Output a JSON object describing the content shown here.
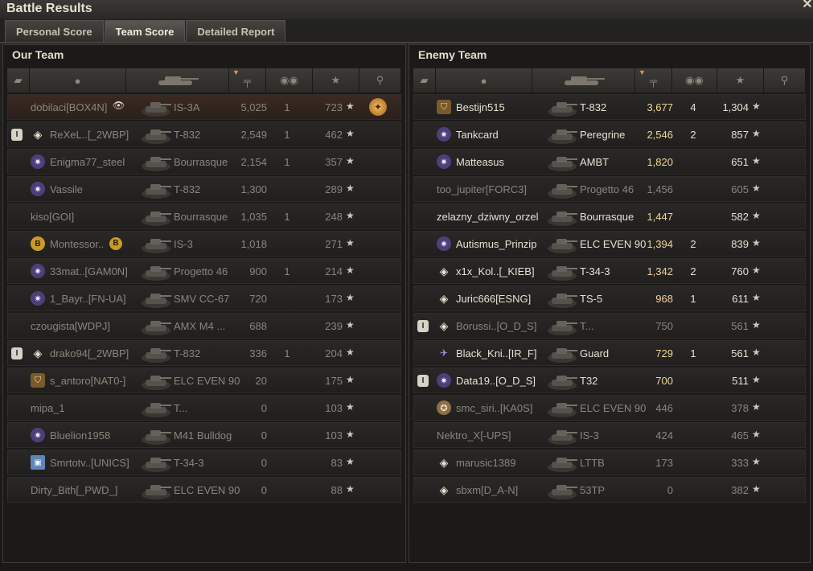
{
  "window": {
    "title": "Battle Results",
    "close_label": "✕"
  },
  "tabs": [
    {
      "label": "Personal Score",
      "active": false
    },
    {
      "label": "Team Score",
      "active": true
    },
    {
      "label": "Detailed Report",
      "active": false
    }
  ],
  "header_icons": [
    "platoon-icon",
    "player-icon",
    "vehicle-icon",
    "damage-icon",
    "kills-icon",
    "xp-star-icon",
    "medal-icon"
  ],
  "our_team": {
    "title": "Our Team",
    "rows": [
      {
        "name": "dobilaci[BOX4N]",
        "tank": "IS-3A",
        "damage": "5,025",
        "kills": "1",
        "xp": "723",
        "badge": "",
        "platoon": "",
        "alive": false,
        "me": true,
        "eye": true,
        "medal": true
      },
      {
        "name": "ReXeL..[_2WBP]",
        "tank": "T-832",
        "damage": "2,549",
        "kills": "1",
        "xp": "462",
        "badge": "diamond",
        "platoon": "I",
        "alive": false
      },
      {
        "name": "Enigma77_steel",
        "tank": "Bourrasque",
        "damage": "2,154",
        "kills": "1",
        "xp": "357",
        "badge": "star",
        "platoon": "",
        "alive": false
      },
      {
        "name": "Vassile",
        "tank": "T-832",
        "damage": "1,300",
        "kills": "",
        "xp": "289",
        "badge": "star",
        "platoon": "",
        "alive": false
      },
      {
        "name": "kiso[GOI]",
        "tank": "Bourrasque",
        "damage": "1,035",
        "kills": "1",
        "xp": "248",
        "badge": "",
        "platoon": "",
        "alive": false
      },
      {
        "name": "Montessor..",
        "tank": "IS-3",
        "damage": "1,018",
        "kills": "",
        "xp": "271",
        "badge": "coin",
        "platoon": "",
        "alive": false,
        "badge2": true
      },
      {
        "name": "33mat..[GAM0N]",
        "tank": "Progetto 46",
        "damage": "900",
        "kills": "1",
        "xp": "214",
        "badge": "star",
        "platoon": "",
        "alive": false
      },
      {
        "name": "1_Bayr..[FN-UA]",
        "tank": "SMV CC-67",
        "damage": "720",
        "kills": "",
        "xp": "173",
        "badge": "star",
        "platoon": "",
        "alive": false
      },
      {
        "name": "czougista[WDPJ]",
        "tank": "AMX M4 ...",
        "damage": "688",
        "kills": "",
        "xp": "239",
        "badge": "",
        "platoon": "",
        "alive": false
      },
      {
        "name": "drako94[_2WBP]",
        "tank": "T-832",
        "damage": "336",
        "kills": "1",
        "xp": "204",
        "badge": "diamond",
        "platoon": "I",
        "alive": false
      },
      {
        "name": "s_antoro[NAT0-]",
        "tank": "ELC EVEN 90",
        "damage": "20",
        "kills": "",
        "xp": "175",
        "badge": "shield",
        "platoon": "",
        "alive": false
      },
      {
        "name": "mipa_1",
        "tank": "T...",
        "damage": "0",
        "kills": "",
        "xp": "103",
        "badge": "",
        "platoon": "",
        "alive": false
      },
      {
        "name": "Bluelion1958",
        "tank": "M41 Bulldog",
        "damage": "0",
        "kills": "",
        "xp": "103",
        "badge": "star",
        "platoon": "",
        "alive": false
      },
      {
        "name": "Smrtotv..[UNICS]",
        "tank": "T-34-3",
        "damage": "0",
        "kills": "",
        "xp": "83",
        "badge": "box",
        "platoon": "",
        "alive": false
      },
      {
        "name": "Dirty_Bith[_PWD_]",
        "tank": "ELC EVEN 90",
        "damage": "0",
        "kills": "",
        "xp": "88",
        "badge": "",
        "platoon": "",
        "alive": false
      }
    ]
  },
  "enemy_team": {
    "title": "Enemy Team",
    "rows": [
      {
        "name": "Bestijn515",
        "tank": "T-832",
        "damage": "3,677",
        "kills": "4",
        "xp": "1,304",
        "badge": "shield",
        "platoon": "",
        "alive": true
      },
      {
        "name": "Tankcard",
        "tank": "Peregrine",
        "damage": "2,546",
        "kills": "2",
        "xp": "857",
        "badge": "star",
        "platoon": "",
        "alive": true
      },
      {
        "name": "Matteasus",
        "tank": "AMBT",
        "damage": "1,820",
        "kills": "",
        "xp": "651",
        "badge": "star",
        "platoon": "",
        "alive": true
      },
      {
        "name": "too_jupiter[FORC3]",
        "tank": "Progetto 46",
        "damage": "1,456",
        "kills": "",
        "xp": "605",
        "badge": "",
        "platoon": "",
        "alive": false
      },
      {
        "name": "zelazny_dziwny_orzel",
        "tank": "Bourrasque",
        "damage": "1,447",
        "kills": "",
        "xp": "582",
        "badge": "",
        "platoon": "",
        "alive": true
      },
      {
        "name": "Autismus_Prinzip",
        "tank": "ELC EVEN 90",
        "damage": "1,394",
        "kills": "2",
        "xp": "839",
        "badge": "star",
        "platoon": "",
        "alive": true
      },
      {
        "name": "x1x_Kol..[_KIEB]",
        "tank": "T-34-3",
        "damage": "1,342",
        "kills": "2",
        "xp": "760",
        "badge": "diamond",
        "platoon": "",
        "alive": true
      },
      {
        "name": "Juric666[ESNG]",
        "tank": "TS-5",
        "damage": "968",
        "kills": "1",
        "xp": "611",
        "badge": "diamond",
        "platoon": "",
        "alive": true
      },
      {
        "name": "Borussi..[O_D_S]",
        "tank": "T...",
        "damage": "750",
        "kills": "",
        "xp": "561",
        "badge": "diamond",
        "platoon": "I",
        "alive": false
      },
      {
        "name": "Black_Kni..[IR_F]",
        "tank": "Guard",
        "damage": "729",
        "kills": "1",
        "xp": "561",
        "badge": "wings",
        "platoon": "",
        "alive": true
      },
      {
        "name": "Data19..[O_D_S]",
        "tank": "T32",
        "damage": "700",
        "kills": "",
        "xp": "511",
        "badge": "star",
        "platoon": "I",
        "alive": true
      },
      {
        "name": "smc_siri..[KA0S]",
        "tank": "ELC EVEN 90",
        "damage": "446",
        "kills": "",
        "xp": "378",
        "badge": "target",
        "platoon": "",
        "alive": false
      },
      {
        "name": "Nektro_X[-UPS]",
        "tank": "IS-3",
        "damage": "424",
        "kills": "",
        "xp": "465",
        "badge": "",
        "platoon": "",
        "alive": false
      },
      {
        "name": "marusic1389",
        "tank": "LTTB",
        "damage": "173",
        "kills": "",
        "xp": "333",
        "badge": "diamond",
        "platoon": "",
        "alive": false
      },
      {
        "name": "sbxm[D_A-N]",
        "tank": "53TP",
        "damage": "0",
        "kills": "",
        "xp": "382",
        "badge": "diamond",
        "platoon": "",
        "alive": false
      }
    ]
  },
  "colors": {
    "accent": "#d6a12c",
    "alive_text": "#e7e1d2",
    "dead_text": "#8a857b",
    "damage_alive": "#f0d49a"
  }
}
